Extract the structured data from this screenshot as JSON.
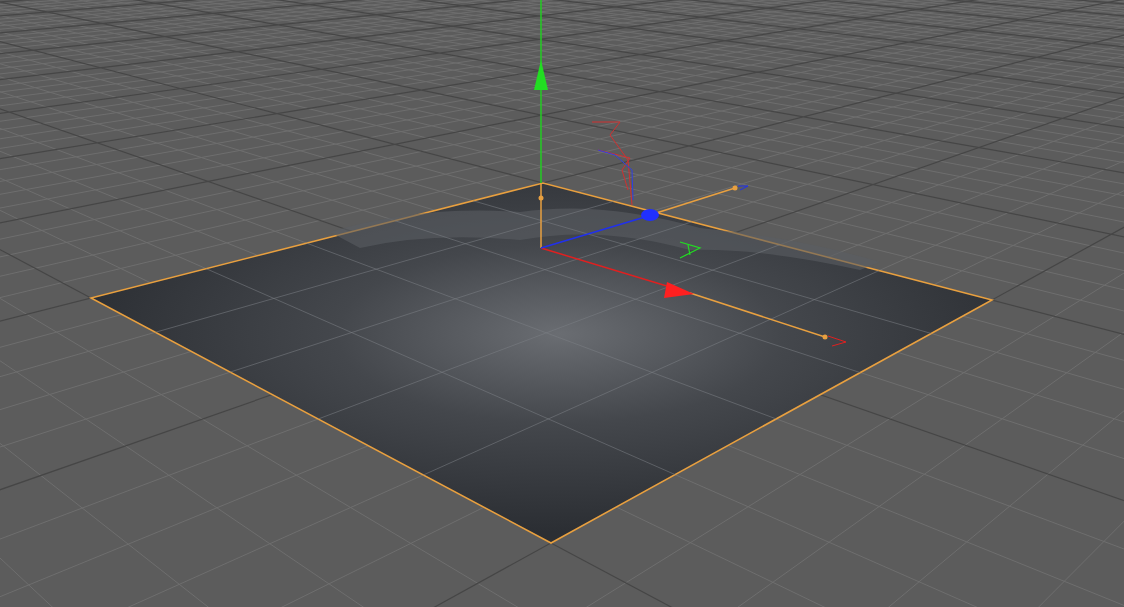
{
  "viewport": {
    "objects": [
      {
        "kind": "landscape",
        "selected": true
      }
    ]
  }
}
